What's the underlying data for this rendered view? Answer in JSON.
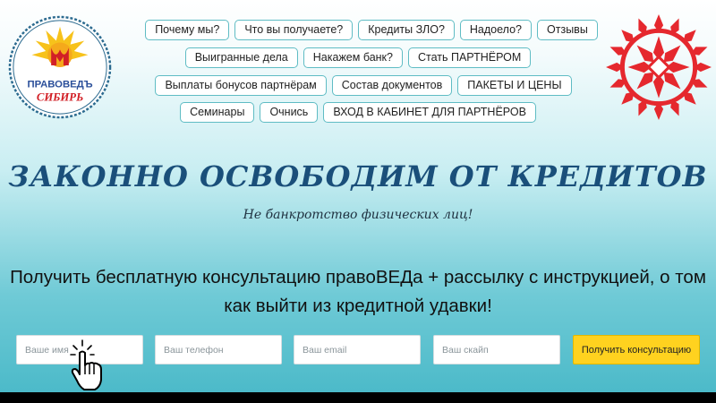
{
  "logo": {
    "line1": "ПРАВОВЕДЪ",
    "line2": "СИБИРЬ"
  },
  "nav": {
    "row1": [
      "Почему мы?",
      "Что вы получаете?",
      "Кредиты ЗЛО?",
      "Надоело?",
      "Отзывы"
    ],
    "row2": [
      "Выигранные дела",
      "Накажем банк?",
      "Стать ПАРТНЁРОМ"
    ],
    "row3": [
      "Выплаты бонусов партнёрам",
      "Состав документов",
      "ПАКЕТЫ И ЦЕНЫ"
    ],
    "row4": [
      "Семинары",
      "Очнись",
      "ВХОД В КАБИНЕТ ДЛЯ ПАРТНЁРОВ"
    ]
  },
  "hero": {
    "headline": "ЗАКОННО ОСВОБОДИМ ОТ КРЕДИТОВ",
    "subheadline": "Не банкротство физических лиц!",
    "offer": "Получить бесплатную консультацию правоВЕДа + рассылку с инструкцией, о том как выйти из кредитной удавки!"
  },
  "form": {
    "name_placeholder": "Ваше имя",
    "phone_placeholder": "Ваш телефон",
    "email_placeholder": "Ваш email",
    "skype_placeholder": "Ваш скайп",
    "submit_label": "Получить консультацию"
  },
  "icons": {
    "logo": "sun-logo-icon",
    "emblem": "slavic-symbol-icon",
    "cursor": "hand-pointer-icon"
  },
  "colors": {
    "headline": "#1a4f7a",
    "nav_border": "#5fbcc4",
    "submit": "#ffd21f",
    "emblem_red": "#e5282e"
  }
}
